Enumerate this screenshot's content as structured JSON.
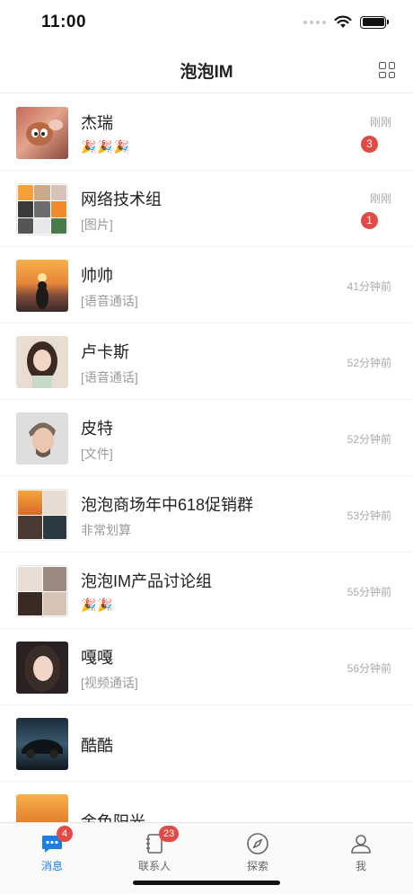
{
  "status_bar": {
    "time": "11:00"
  },
  "header": {
    "title": "泡泡IM",
    "grid_icon": "grid-icon"
  },
  "chats": [
    {
      "name": "杰瑞",
      "preview": "🎉🎉🎉",
      "time": "刚刚",
      "unread": "3"
    },
    {
      "name": "网络技术组",
      "preview": "[图片]",
      "time": "刚刚",
      "unread": "1"
    },
    {
      "name": "帅帅",
      "preview": "[语音通话]",
      "time": "41分钟前"
    },
    {
      "name": "卢卡斯",
      "preview": "[语音通话]",
      "time": "52分钟前"
    },
    {
      "name": "皮特",
      "preview": "[文件]",
      "time": "52分钟前"
    },
    {
      "name": "泡泡商场年中618促销群",
      "preview": "非常划算",
      "time": "53分钟前"
    },
    {
      "name": "泡泡IM产品讨论组",
      "preview": "🎉🎉",
      "time": "55分钟前"
    },
    {
      "name": "嘎嘎",
      "preview": "[视频通话]",
      "time": "56分钟前"
    },
    {
      "name": "酷酷"
    },
    {
      "name": "金色阳光"
    }
  ],
  "tabs": [
    {
      "label": "消息",
      "icon": "chat-bubble-icon",
      "badge": "4"
    },
    {
      "label": "联系人",
      "icon": "contacts-book-icon",
      "badge": "23"
    },
    {
      "label": "探索",
      "icon": "compass-icon"
    },
    {
      "label": "我",
      "icon": "person-icon"
    }
  ],
  "colors": {
    "accent": "#1a7fe0",
    "badge": "#e14b45"
  }
}
